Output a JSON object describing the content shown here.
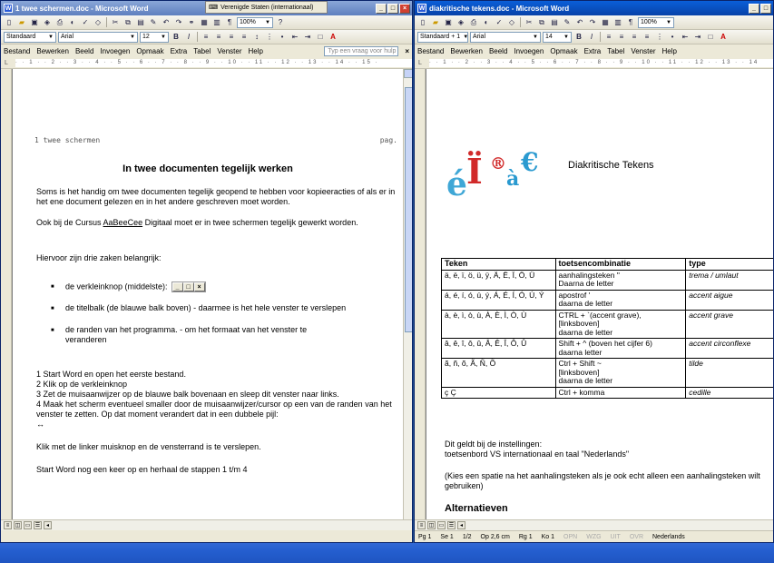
{
  "win1": {
    "title": "1 twee schermen.doc - Microsoft Word",
    "float_title": "Verenigde Staten (internationaal)",
    "style": "Standaard",
    "font": "Arial",
    "size": "12",
    "zoom": "100%",
    "menu": [
      "Bestand",
      "Bewerken",
      "Beeld",
      "Invoegen",
      "Opmaak",
      "Extra",
      "Tabel",
      "Venster",
      "Help"
    ],
    "help_placeholder": "Typ een vraag voor hulp",
    "header_left": "1 twee schermen",
    "header_right": "pag.",
    "heading": "In twee documenten tegelijk werken",
    "para1": "Soms is het handig om twee documenten tegelijk geopend te hebben voor kopieeracties of als er in het ene document gelezen en in het andere geschreven moet worden.",
    "para2a": "Ook bij de Cursus ",
    "para2link": "AaBeeCee",
    "para2b": " Digitaal moet er in twee schermen tegelijk gewerkt worden.",
    "para3": "Hiervoor zijn drie zaken belangrijk:",
    "bullet1": "de verkleinknop  (middelste):",
    "bullet2": "de titelbalk (de blauwe balk boven) - daarmee is het hele venster te verslepen",
    "bullet3": "de randen van het programma. - om het formaat van het venster te veranderen",
    "step1": "1 Start Word en open het eerste bestand.",
    "step2": "2 Klik op de verkleinknop",
    "step3": "3 Zet de muisaanwijzer op de blauwe balk bovenaan en sleep dit venster naar links.",
    "step4": "4 Maak het scherm eventueel smaller door de muisaanwijzer/cursor op een van de randen van het venster te zetten. Op dat moment verandert dat in een dubbele pijl:",
    "step4arrow": "↔",
    "step5": "Klik met de linker muisknop en de vensterrand is te verslepen.",
    "step6": "Start Word nog een keer op en herhaal de stappen 1 t/m 4"
  },
  "win2": {
    "title": "diakritische tekens.doc - Microsoft Word",
    "style": "Standaard + 1",
    "font": "Arial",
    "size": "14",
    "zoom": "100%",
    "menu": [
      "Bestand",
      "Bewerken",
      "Beeld",
      "Invoegen",
      "Opmaak",
      "Extra",
      "Tabel",
      "Venster",
      "Help"
    ],
    "logo_text": "éÏ®à€",
    "heading": "Diakritische Tekens",
    "table_headers": [
      "Teken",
      "toetsencombinatie",
      "type"
    ],
    "rows": [
      {
        "teken": "ä, ë, ï, ö, ü, ÿ, Ä, Ë, Ï, Ö, Ü",
        "combo": "aanhalingsteken \"\nDaarna de letter",
        "type": "trema / umlaut"
      },
      {
        "teken": "á, é, í, ó, ú, ý, Á, É, Í, Ó, Ú, Ý",
        "combo": "apostrof '\ndaarna de letter",
        "type": "accent aigue"
      },
      {
        "teken": "à, è, ì, ò, ù, À, È, Ì, Ò, Ù",
        "combo": "CTRL + `(accent grave),\n[linksboven]\ndaarna de letter",
        "type": "accent grave"
      },
      {
        "teken": "â, ê, î, ô, û, Â, Ê, Î, Ô, Û",
        "combo": "Shift + ^ (boven het cijfer 6)\ndaarna letter",
        "type": "accent circonflexe"
      },
      {
        "teken": "ã, ñ, õ, Ã, Ñ, Õ",
        "combo": "Ctrl + Shift ~\n[linksboven]\ndaarna de letter",
        "type": "tilde"
      },
      {
        "teken": "ç Ç",
        "combo": "Ctrl + komma",
        "type": "cedille"
      }
    ],
    "note1": "Dit geldt bij de instellingen:",
    "note2": "toetsenbord VS internationaal en taal \"Nederlands\"",
    "note3": "(Kies een spatie na het aanhalingsteken als je ook echt alleen een aanhalingsteken wilt gebruiken)",
    "h2": "Alternatieven",
    "status": {
      "pg": "Pg 1",
      "se": "Se 1",
      "pages": "1/2",
      "op": "Op 2,6 cm",
      "rg": "Rg 1",
      "ko": "Ko 1",
      "opn": "OPN",
      "wzg": "WZG",
      "uit": "UIT",
      "ovr": "OVR",
      "lang": "Nederlands"
    }
  }
}
